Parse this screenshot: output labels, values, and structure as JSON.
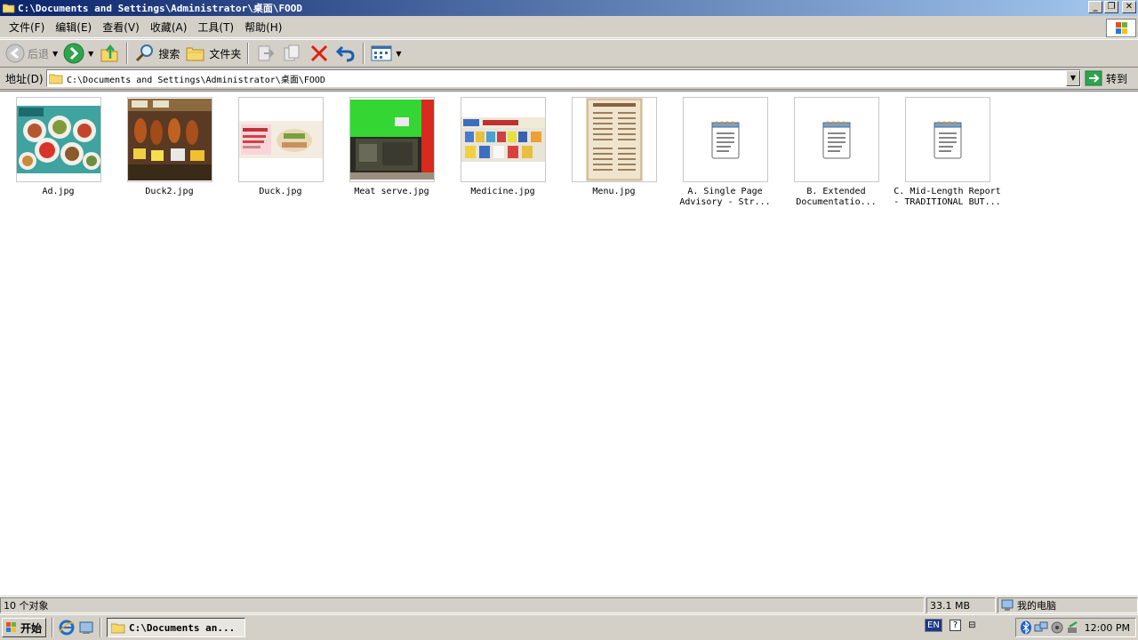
{
  "window": {
    "title": "C:\\Documents and Settings\\Administrator\\桌面\\FOOD",
    "buttons": {
      "minimize": "_",
      "restore": "❐",
      "close": "✕"
    }
  },
  "menu": [
    "文件(F)",
    "编辑(E)",
    "查看(V)",
    "收藏(A)",
    "工具(T)",
    "帮助(H)"
  ],
  "toolbar": {
    "back_label": "后退",
    "search_label": "搜索",
    "folders_label": "文件夹"
  },
  "address": {
    "label": "地址(D)",
    "value": "C:\\Documents and Settings\\Administrator\\桌面\\FOOD",
    "go_label": "转到"
  },
  "files": [
    {
      "name": "Ad.jpg",
      "kind": "image"
    },
    {
      "name": "Duck2.jpg",
      "kind": "image"
    },
    {
      "name": "Duck.jpg",
      "kind": "image"
    },
    {
      "name": "Meat serve.jpg",
      "kind": "image"
    },
    {
      "name": "Medicine.jpg",
      "kind": "image"
    },
    {
      "name": "Menu.jpg",
      "kind": "image"
    },
    {
      "name": "A. Single Page Advisory - Str...",
      "kind": "text"
    },
    {
      "name": "B. Extended Documentatio...",
      "kind": "text"
    },
    {
      "name": "C. Mid-Length Report - TRADITIONAL BUT...",
      "kind": "text"
    }
  ],
  "status": {
    "count": "10 个对象",
    "size": "33.1 MB",
    "location": "我的电脑"
  },
  "taskbar": {
    "start_label": "开始",
    "task_label": "C:\\Documents an...",
    "lang": "EN",
    "help": "?",
    "clock": "12:00 PM"
  },
  "colors": {
    "titlebar_start": "#0a246a",
    "titlebar_end": "#a6caf0",
    "chrome": "#d4d0c8",
    "delete_red": "#e02010",
    "go_green": "#2ea44f"
  }
}
